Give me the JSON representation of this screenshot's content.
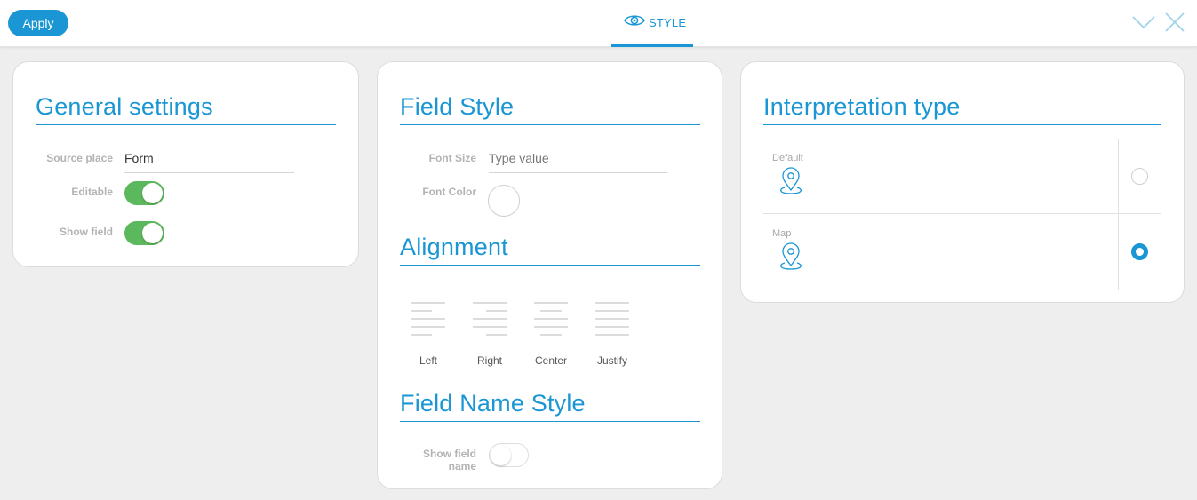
{
  "toolbar": {
    "apply_label": "Apply",
    "tab_label": "STYLE",
    "accent_color": "#1a96d4"
  },
  "general": {
    "heading": "General settings",
    "source_place_label": "Source place",
    "source_place_value": "Form",
    "editable_label": "Editable",
    "editable_on": true,
    "show_field_label": "Show field",
    "show_field_on": true,
    "toggle_on_color": "#5cb85c"
  },
  "field_style": {
    "heading": "Field Style",
    "font_size_label": "Font Size",
    "font_size_placeholder": "Type value",
    "font_color_label": "Font Color"
  },
  "alignment": {
    "heading": "Alignment",
    "options": [
      {
        "label": "Left",
        "icon": "align-left-icon"
      },
      {
        "label": "Right",
        "icon": "align-right-icon"
      },
      {
        "label": "Center",
        "icon": "align-center-icon"
      },
      {
        "label": "Justify",
        "icon": "align-justify-icon"
      }
    ]
  },
  "field_name_style": {
    "heading": "Field Name Style",
    "show_field_name_label_1": "Show field",
    "show_field_name_label_2": "name",
    "show_field_name_on": false
  },
  "interpretation": {
    "heading": "Interpretation type",
    "options": [
      {
        "label": "Default",
        "icon": "map-pin-icon",
        "selected": false
      },
      {
        "label": "Map",
        "icon": "map-pin-icon",
        "selected": true
      }
    ]
  }
}
